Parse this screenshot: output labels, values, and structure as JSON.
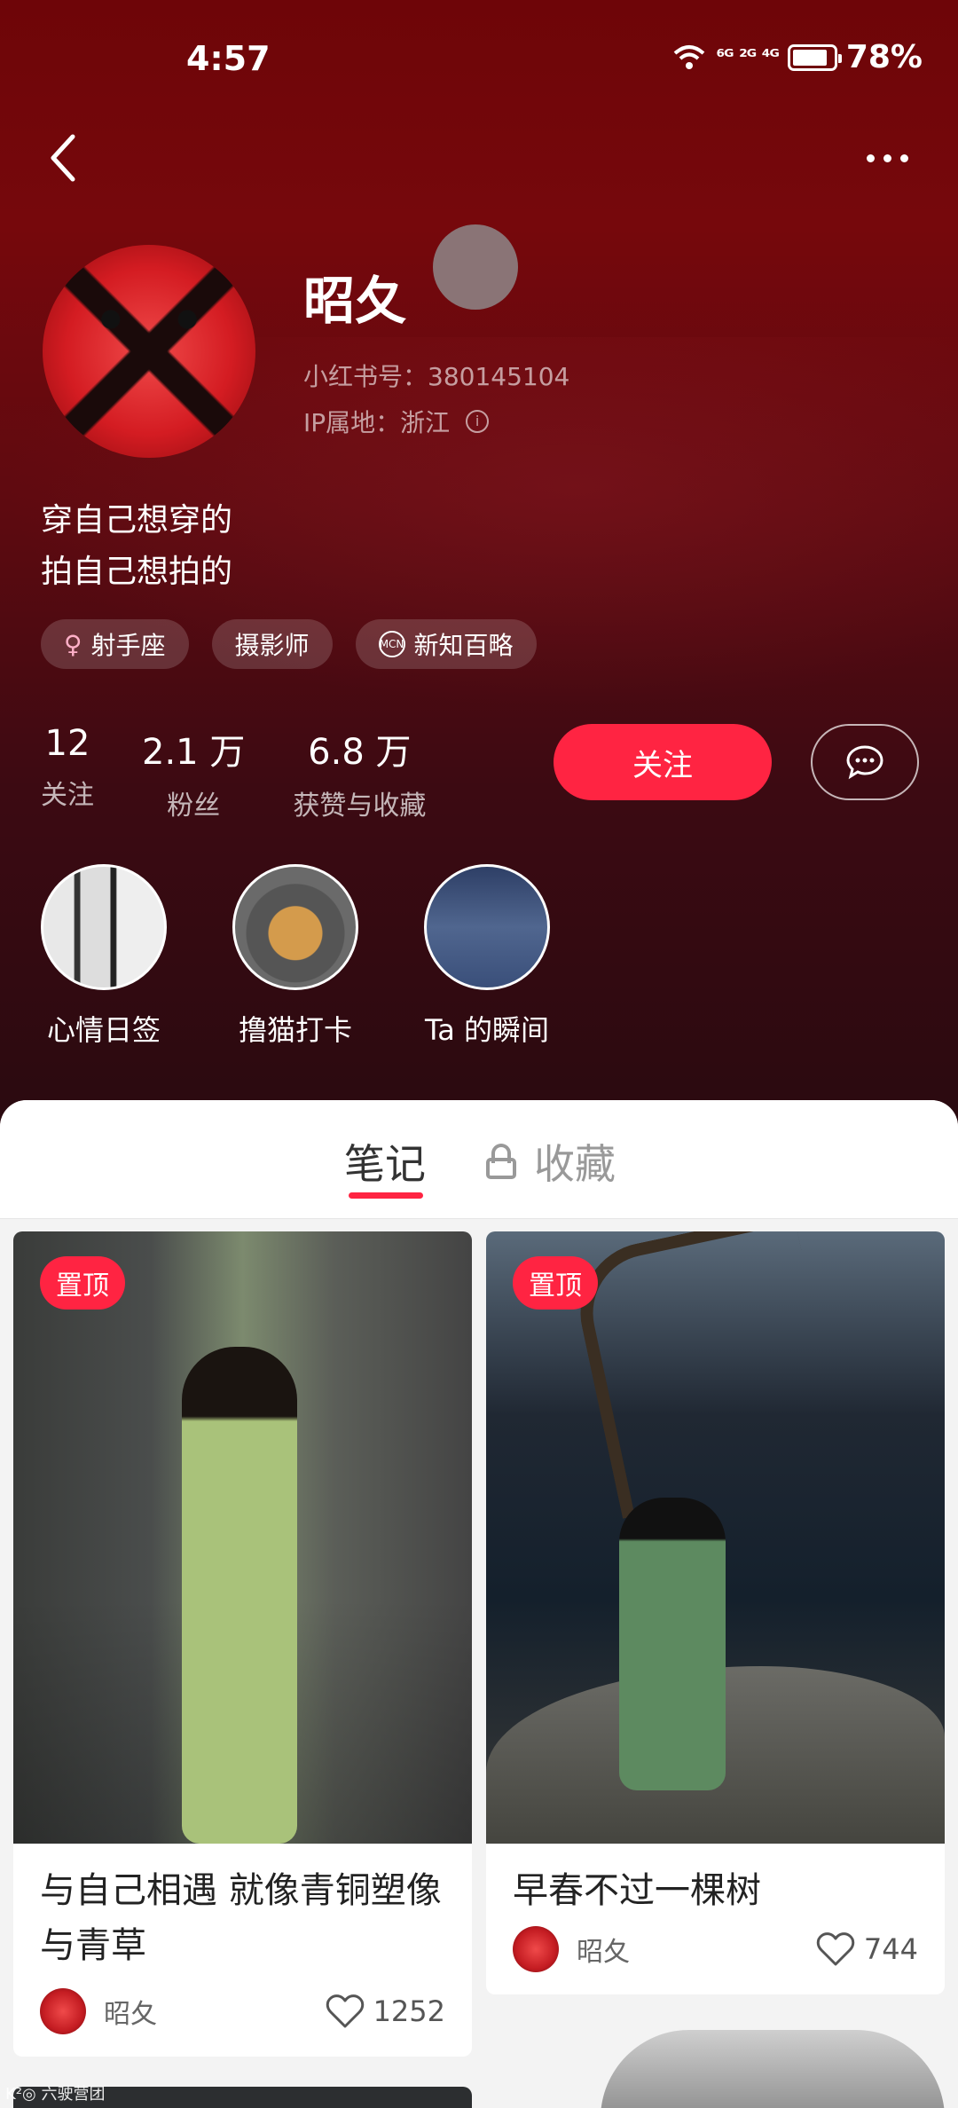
{
  "status_bar": {
    "time": "4:57",
    "network": "⁶ᴳ ²ᴳ ⁴ᴳ",
    "battery": "78%"
  },
  "profile": {
    "nickname": "昭夂",
    "id_line": "小红书号：380145104",
    "ip_line": "IP属地：浙江",
    "bio_line1": "穿自己想穿的",
    "bio_line2": "拍自己想拍的",
    "tags": [
      {
        "icon": "♀",
        "label": "射手座"
      },
      {
        "label": "摄影师"
      },
      {
        "icon": "MCN",
        "label": "新知百略"
      }
    ],
    "stats": [
      {
        "num": "12",
        "label": "关注"
      },
      {
        "num": "2.1 万",
        "label": "粉丝"
      },
      {
        "num": "6.8 万",
        "label": "获赞与收藏"
      }
    ],
    "follow_label": "关注",
    "highlights": [
      {
        "label": "心情日签"
      },
      {
        "label": "撸猫打卡"
      },
      {
        "label": "Ta 的瞬间"
      }
    ]
  },
  "tabs": {
    "notes": "笔记",
    "favorites": "收藏"
  },
  "notes": [
    {
      "pinned": "置顶",
      "title": "与自己相遇 就像青铜塑像与青草",
      "author": "昭夂",
      "likes": "1252"
    },
    {
      "pinned": "置顶",
      "title": "早春不过一棵树",
      "author": "昭夂",
      "likes": "744"
    }
  ],
  "colors": {
    "accent": "#ff2442",
    "hero_top": "#6e0508",
    "hero_bottom": "#2a0a10"
  },
  "watermark": "K²◎ 六驶营团"
}
